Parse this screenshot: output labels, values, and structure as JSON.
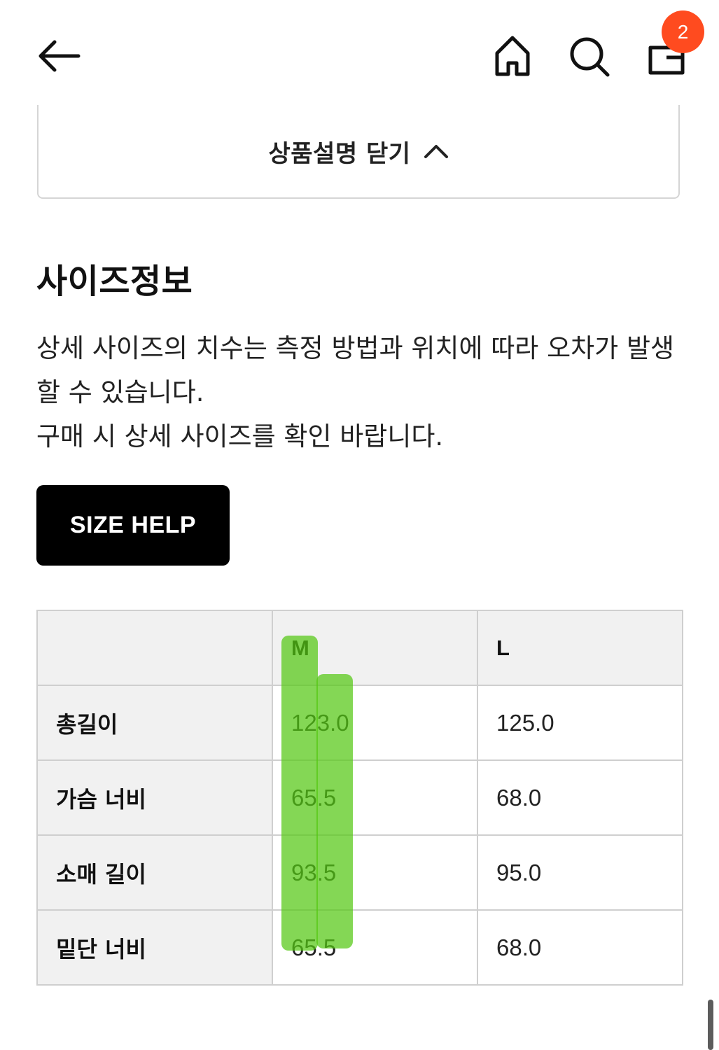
{
  "header": {
    "icons": {
      "back": "arrow-left-icon",
      "home": "home-icon",
      "search": "search-icon",
      "cart": "shopping-bag-icon"
    },
    "cart_count": "2",
    "badge_color": "#ff4b1f"
  },
  "description": {
    "collapse_label": "상품설명 닫기"
  },
  "size_info": {
    "title": "사이즈정보",
    "notice_line1": "상세 사이즈의 치수는 측정 방법과 위치에 따라 오차가 발생할 수 있습니다.",
    "notice_line2": "구매 시 상세 사이즈를 확인 바랍니다.",
    "size_help_label": "SIZE HELP"
  },
  "table": {
    "columns": [
      "",
      "M",
      "L"
    ],
    "rows": [
      {
        "label": "총길이",
        "values": [
          "123.0",
          "125.0"
        ]
      },
      {
        "label": "가슴 너비",
        "values": [
          "65.5",
          "68.0"
        ]
      },
      {
        "label": "소매 길이",
        "values": [
          "93.5",
          "95.0"
        ]
      },
      {
        "label": "밑단 너비",
        "values": [
          "65.5",
          "68.0"
        ]
      }
    ]
  },
  "highlight": {
    "color": "#54c814",
    "target": "M column"
  }
}
